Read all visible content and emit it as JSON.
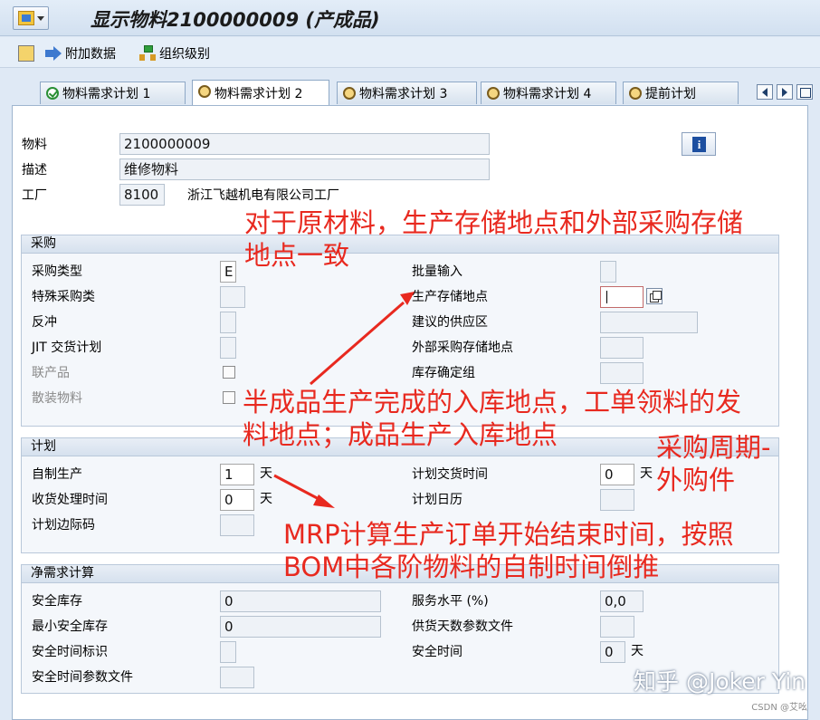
{
  "window": {
    "title": "显示物料2100000009 (产成品)"
  },
  "toolbar": {
    "additional_data": "附加数据",
    "org_levels": "组织级别"
  },
  "tabs": [
    {
      "label": "物料需求计划 1",
      "icon": "check-circle-icon"
    },
    {
      "label": "物料需求计划 2",
      "icon": "ring-icon",
      "active": true
    },
    {
      "label": "物料需求计划 3",
      "icon": "ring-icon"
    },
    {
      "label": "物料需求计划 4",
      "icon": "ring-icon"
    },
    {
      "label": "提前计划",
      "icon": "ring-icon"
    }
  ],
  "header": {
    "material_label": "物料",
    "material_value": "2100000009",
    "desc_label": "描述",
    "desc_value": "维修物料",
    "plant_label": "工厂",
    "plant_value": "8100",
    "plant_name": "浙江飞越机电有限公司工厂",
    "info_button": "i"
  },
  "procurement": {
    "title": "采购",
    "type_label": "采购类型",
    "type_value": "E",
    "special_label": "特殊采购类",
    "special_value": "",
    "backflush_label": "反冲",
    "backflush_value": "",
    "jit_label": "JIT 交货计划",
    "jit_value": "",
    "coproduct_label": "联产品",
    "bulk_label": "散装物料",
    "batch_entry_label": "批量输入",
    "batch_entry_value": "",
    "prod_sloc_label": "生产存储地点",
    "prod_sloc_value": "",
    "supply_area_label": "建议的供应区",
    "supply_area_value": "",
    "ext_sloc_label": "外部采购存储地点",
    "ext_sloc_value": "",
    "stock_group_label": "库存确定组",
    "stock_group_value": ""
  },
  "scheduling": {
    "title": "计划",
    "inhouse_label": "自制生产",
    "inhouse_value": "1",
    "inhouse_unit": "天",
    "gr_time_label": "收货处理时间",
    "gr_time_value": "0",
    "gr_time_unit": "天",
    "margin_label": "计划边际码",
    "margin_value": "",
    "pdt_label": "计划交货时间",
    "pdt_value": "0",
    "pdt_unit": "天",
    "calendar_label": "计划日历",
    "calendar_value": ""
  },
  "net_req": {
    "title": "净需求计算",
    "safety_stock_label": "安全库存",
    "safety_stock_value": "0",
    "min_safety_label": "最小安全库存",
    "min_safety_value": "0",
    "safety_time_ind_label": "安全时间标识",
    "safety_time_ind_value": "",
    "safety_time_profile_label": "安全时间参数文件",
    "safety_time_profile_value": "",
    "service_level_label": "服务水平 (%)",
    "service_level_value": "0,0",
    "coverage_profile_label": "供货天数参数文件",
    "coverage_profile_value": "",
    "safety_time_label": "安全时间",
    "safety_time_value": "0",
    "safety_time_unit": "天"
  },
  "annotations": {
    "a1_line1": "对于原材料，生产存储地点和外部采购存储",
    "a1_line2": "地点一致",
    "a2_line1": "半成品生产完成的入库地点，工单领料的发",
    "a2_line2": "料地点；成品生产入库地点",
    "a3_line1": "采购周期-",
    "a3_line2": "外购件",
    "a4_line1": "MRP计算生产订单开始结束时间，按照",
    "a4_line2": "BOM中各阶物料的自制时间倒推",
    "color": "#e8291f"
  },
  "watermark": {
    "main": "知乎 @Joker Yin",
    "sub": "CSDN @艾吆"
  }
}
